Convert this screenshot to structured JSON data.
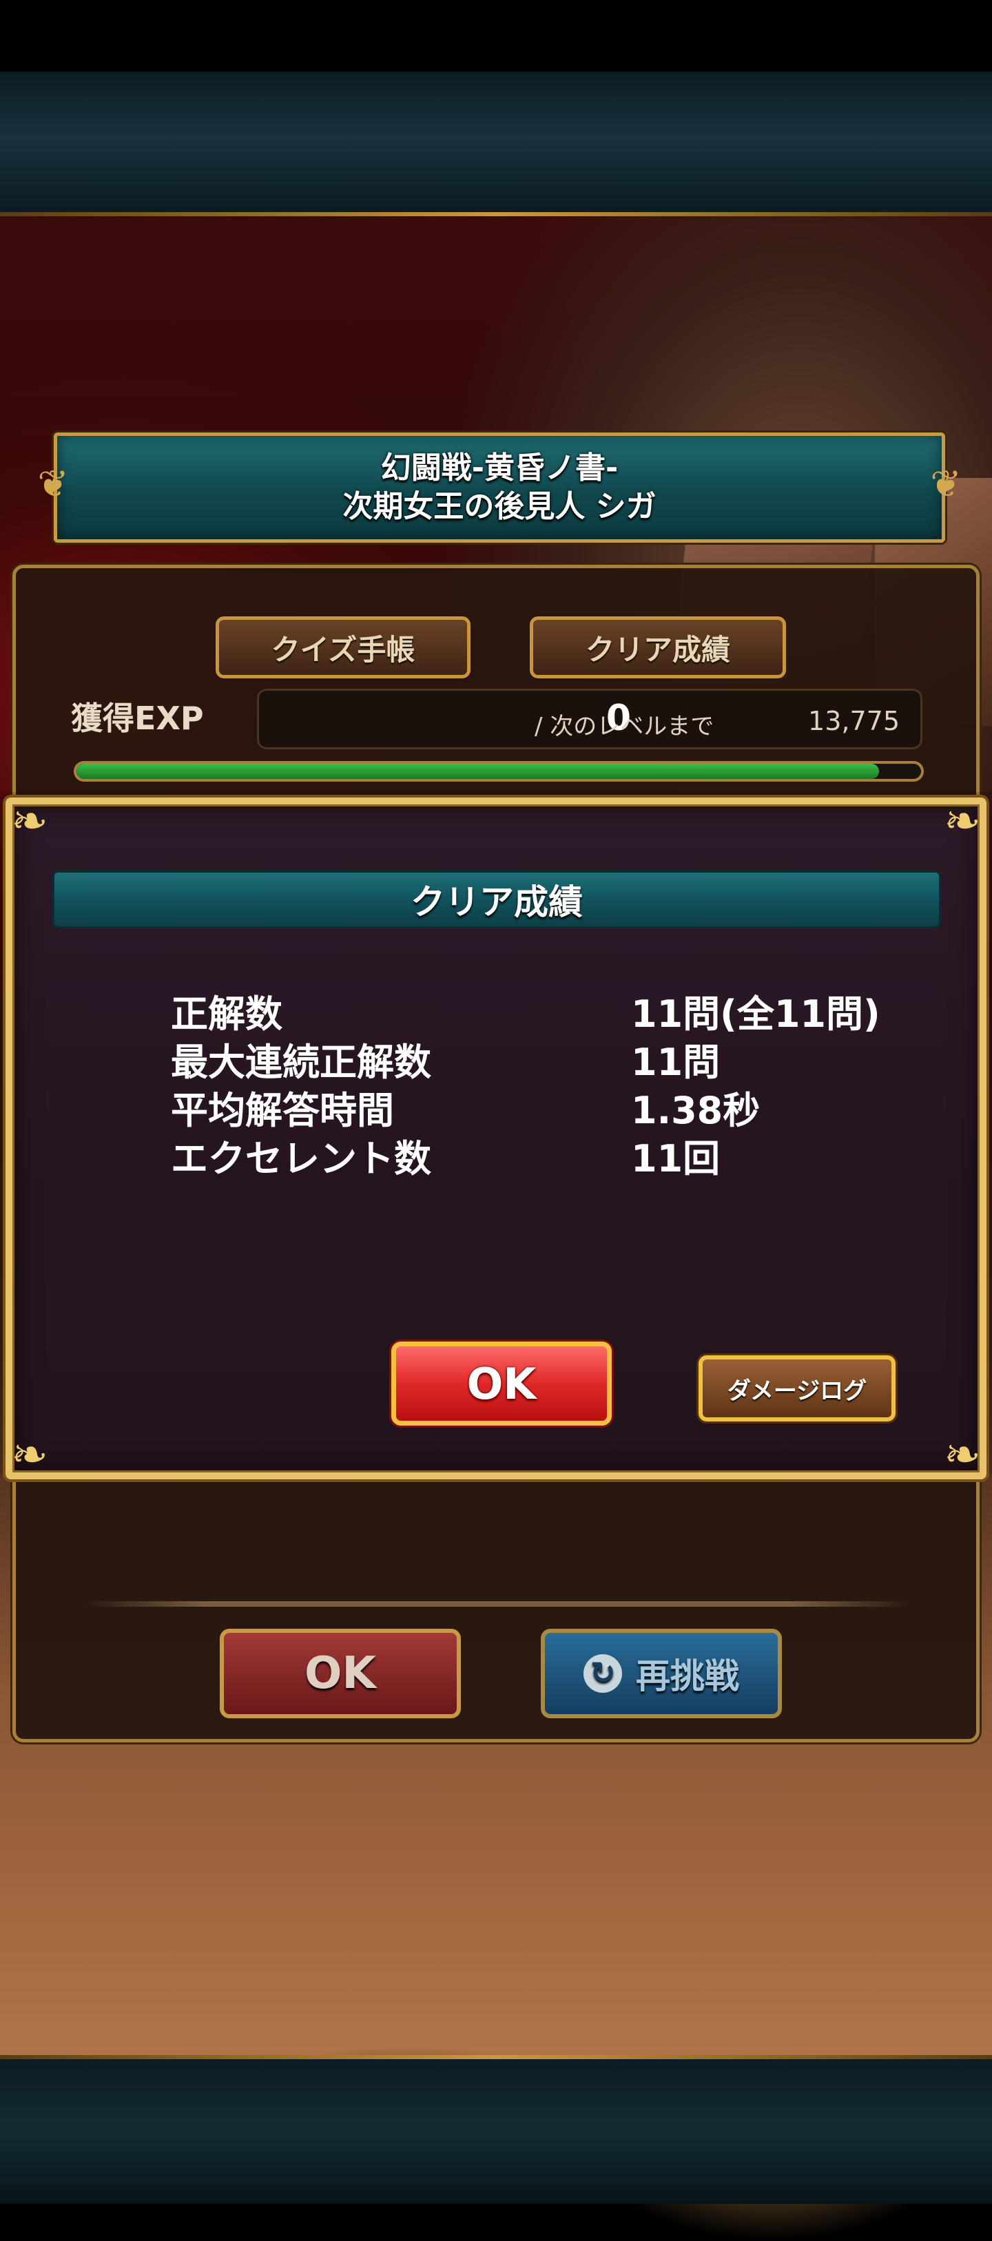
{
  "quest": {
    "title_line1": "幻闘戦-黄昏ノ書-",
    "title_line2": "次期女王の後見人 シガ"
  },
  "results_panel": {
    "quiz_book_label": "クイズ手帳",
    "clear_record_label": "クリア成績",
    "exp_label": "獲得EXP",
    "exp_gained": "0",
    "next_level_label": "/ 次のレベルまで",
    "next_level_value": "13,775",
    "exp_progress_percent": 95,
    "ok_label": "OK",
    "retry_label": "再挑戦"
  },
  "modal": {
    "header": "クリア成績",
    "stats": [
      {
        "label": "正解数",
        "value": "11問(全11問)"
      },
      {
        "label": "最大連続正解数",
        "value": "11問"
      },
      {
        "label": "平均解答時間",
        "value": "1.38秒"
      },
      {
        "label": "エクセレント数",
        "value": "11回"
      }
    ],
    "ok_label": "OK",
    "damage_log_label": "ダメージログ"
  },
  "colors": {
    "gold_border": "#e6c26a",
    "teal_header": "#11505a",
    "modal_bg": "#24141f",
    "ok_red": "#e02828",
    "exp_green": "#38c048"
  }
}
